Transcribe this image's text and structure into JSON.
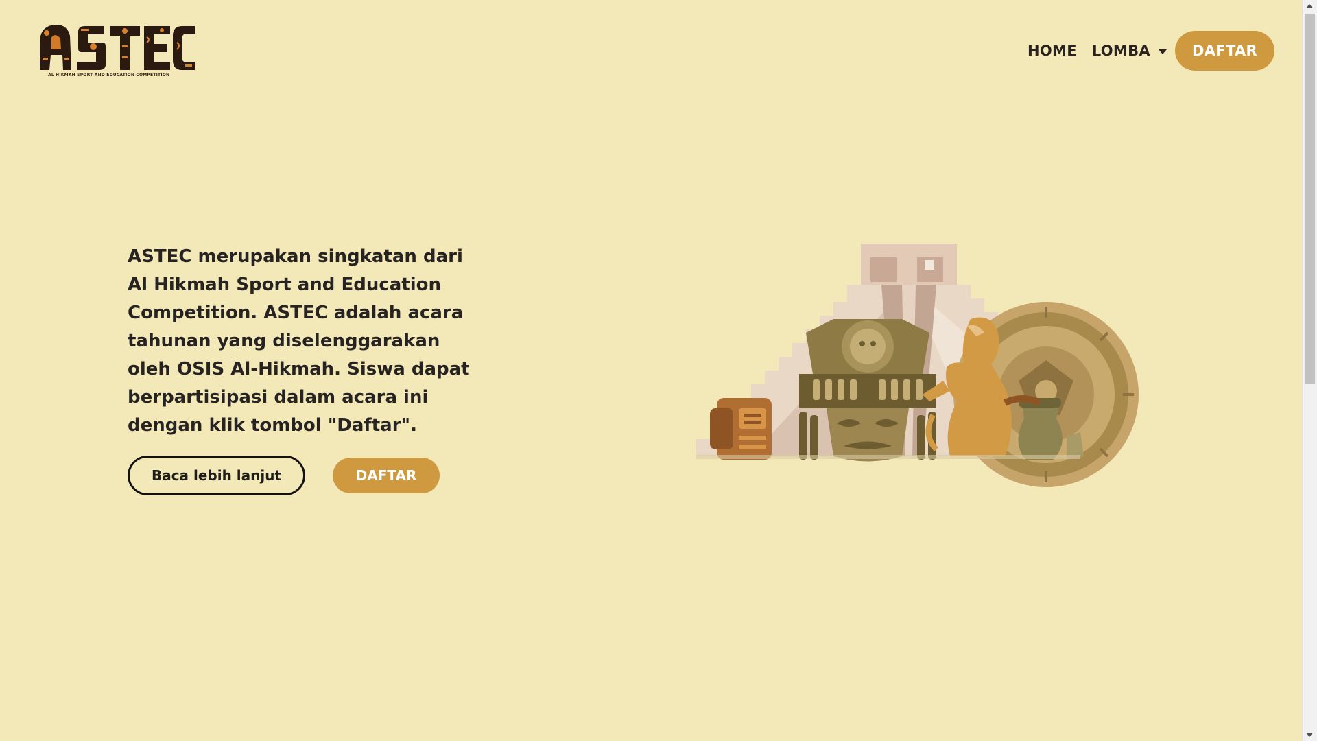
{
  "brand": {
    "logo_text": "ASTEC",
    "tagline": "AL HIKMAH SPORT AND EDUCATION COMPETITION"
  },
  "nav": {
    "home": "HOME",
    "lomba": "LOMBA",
    "daftar": "DAFTAR"
  },
  "hero": {
    "description": "ASTEC merupakan singkatan dari Al Hikmah Sport and Education Competition. ASTEC adalah acara tahunan yang diselenggarakan oleh OSIS Al-Hikmah. Siswa dapat berpartisipasi dalam acara ini dengan klik tombol \"Daftar\".",
    "read_more": "Baca lebih lanjut",
    "daftar": "DAFTAR"
  },
  "colors": {
    "background": "#f3e8b7",
    "accent": "#cf9a3f",
    "text": "#262322"
  }
}
